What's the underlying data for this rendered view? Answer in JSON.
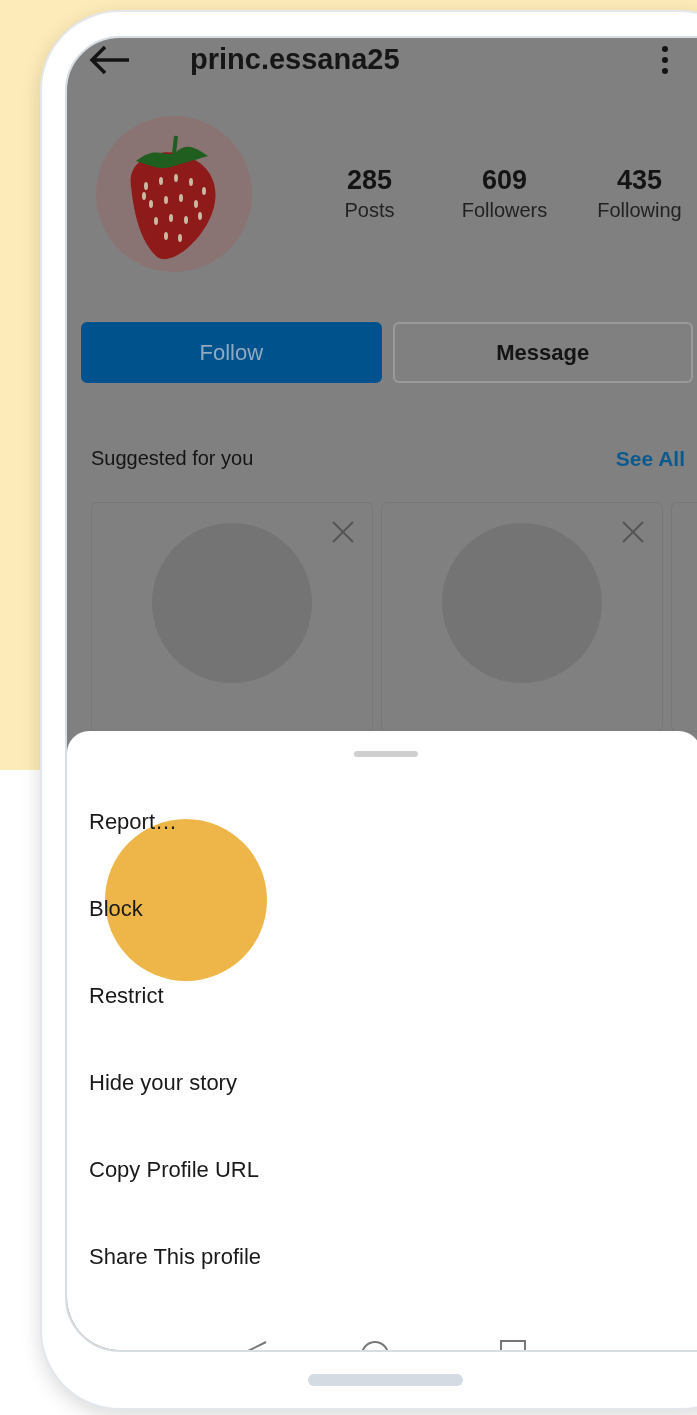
{
  "profile": {
    "username": "princ.essana25",
    "stats": [
      {
        "value": "285",
        "label": "Posts"
      },
      {
        "value": "609",
        "label": "Followers"
      },
      {
        "value": "435",
        "label": "Following"
      }
    ],
    "buttons": [
      {
        "label": "Follow",
        "kind": "primary"
      },
      {
        "label": "Message",
        "kind": "secondary"
      }
    ]
  },
  "suggested": {
    "title": "Suggested for you",
    "link": "See All"
  },
  "sheet": {
    "items": [
      "Report…",
      "Block",
      "Restrict",
      "Hide your story",
      "Copy Profile URL",
      "Share This profile"
    ]
  }
}
